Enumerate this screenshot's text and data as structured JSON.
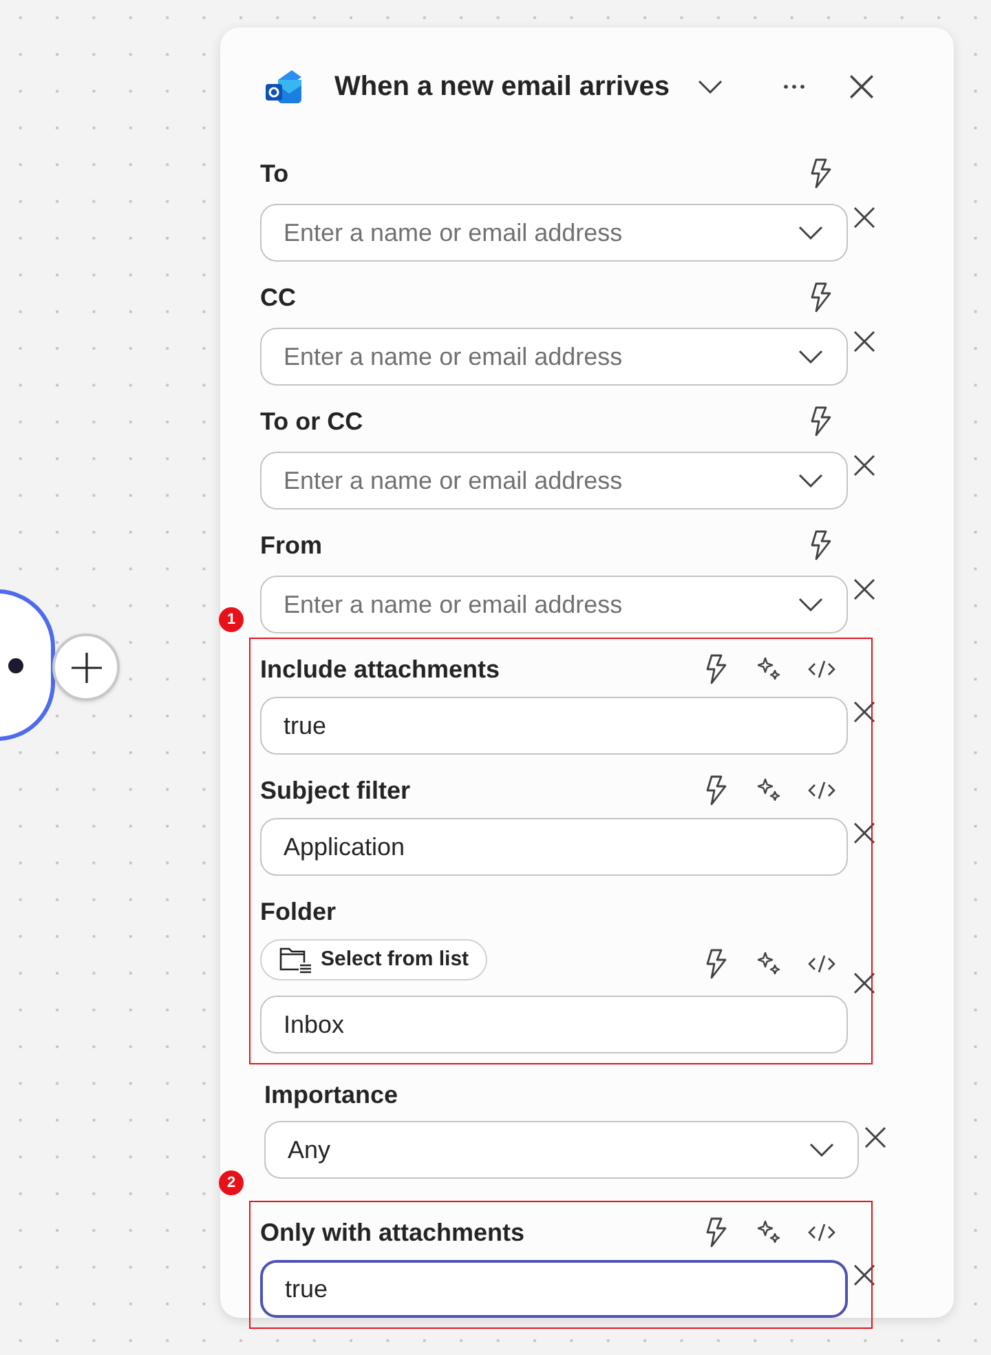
{
  "header": {
    "title": "When a new email arrives"
  },
  "sections": [
    {
      "kind": "plain",
      "fields": [
        {
          "kind": "address",
          "label": "To",
          "placeholder": "Enter a name or email address"
        },
        {
          "kind": "address",
          "label": "CC",
          "placeholder": "Enter a name or email address"
        },
        {
          "kind": "address",
          "label": "To or CC",
          "placeholder": "Enter a name or email address"
        },
        {
          "kind": "address",
          "label": "From",
          "placeholder": "Enter a name or email address"
        }
      ]
    },
    {
      "kind": "annotated",
      "badge": "1",
      "fields": [
        {
          "kind": "text",
          "label": "Include attachments",
          "value": "true",
          "focused": false
        },
        {
          "kind": "text",
          "label": "Subject filter",
          "value": "Application",
          "focused": false
        },
        {
          "kind": "folder",
          "label": "Folder",
          "picker": "Select from list",
          "value": "Inbox",
          "focused": false
        }
      ]
    },
    {
      "kind": "plain",
      "fields": [
        {
          "kind": "choice",
          "label": "Importance",
          "value": "Any"
        }
      ]
    },
    {
      "kind": "annotated",
      "badge": "2",
      "fields": [
        {
          "kind": "text",
          "label": "Only with attachments",
          "value": "true",
          "focused": true
        }
      ]
    }
  ]
}
